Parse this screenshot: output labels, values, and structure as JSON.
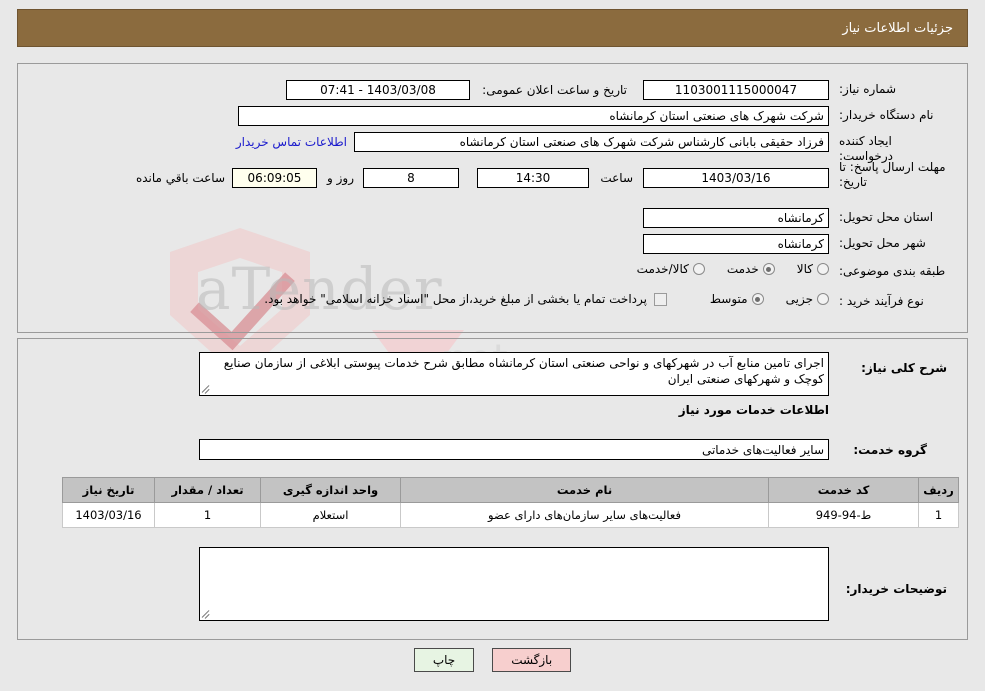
{
  "header": {
    "title": "جزئیات اطلاعات نیاز",
    "bar_color": "#8b6b3e"
  },
  "top_form": {
    "labels": {
      "need_number": "شماره نیاز:",
      "buyer_org": "نام دستگاه خریدار:",
      "requester": "ایجاد کننده درخواست:",
      "deadline": "مهلت ارسال پاسخ: تا تاریخ:",
      "province": "استان محل تحویل:",
      "city": "شهر محل تحویل:",
      "category": "طبقه بندی موضوعی:",
      "process_type": "نوع فرآیند خرید :"
    },
    "need_number": "1103001115000047",
    "buyer_org": "شرکت شهرک های صنعتی استان کرمانشاه",
    "requester": "فرزاد حقیقی بابانی کارشناس شرکت شهرک های صنعتی استان کرمانشاه",
    "contact_link": "اطلاعات تماس خریدار",
    "public_announce_label": "تاریخ و ساعت اعلان عمومی:",
    "public_announce_value": "1403/03/08 - 07:41",
    "deadline_date": "1403/03/16",
    "deadline_time_label": "ساعت",
    "deadline_time": "14:30",
    "days_remaining": "8",
    "days_word": "روز و",
    "hours_remaining": "06:09:05",
    "remaining_suffix": "ساعت باقي مانده",
    "province": "کرمانشاه",
    "city": "کرمانشاه",
    "category_options": [
      {
        "label": "کالا",
        "selected": false
      },
      {
        "label": "خدمت",
        "selected": true
      },
      {
        "label": "کالا/خدمت",
        "selected": false
      }
    ],
    "process_options": [
      {
        "label": "جزیی",
        "selected": false
      },
      {
        "label": "متوسط",
        "selected": true
      }
    ],
    "treasury_checkbox": {
      "checked": false,
      "label": "پرداخت تمام یا بخشی از مبلغ خرید،از محل \"اسناد خزانه اسلامی\" خواهد بود."
    }
  },
  "bottom": {
    "need_summary_label": "شرح کلی نیاز:",
    "need_summary_text": "اجرای تامین منابع آب در شهرکهای و نواحی صنعتی استان کرمانشاه مطابق شرح خدمات پیوستی ابلاغی از سازمان صنایع کوچک و شهرکهای صنعتی ایران",
    "services_section_title": "اطلاعات خدمات مورد نیاز",
    "service_group_label": "گروه خدمت:",
    "service_group_value": "سایر فعالیت‌های خدماتی",
    "table": {
      "columns": [
        "ردیف",
        "کد خدمت",
        "نام خدمت",
        "واحد اندازه گیری",
        "تعداد / مقدار",
        "تاریخ نیاز"
      ],
      "rows": [
        {
          "row_no": "1",
          "service_code": "ط-94-949",
          "service_name": "فعالیت‌های سایر سازمان‌های دارای عضو",
          "unit": "استعلام",
          "quantity": "1",
          "need_date": "1403/03/16"
        }
      ]
    },
    "buyer_notes_label": "توضیحات خریدار:",
    "buyer_notes_value": ""
  },
  "buttons": {
    "back": "بازگشت",
    "print": "چاپ"
  }
}
